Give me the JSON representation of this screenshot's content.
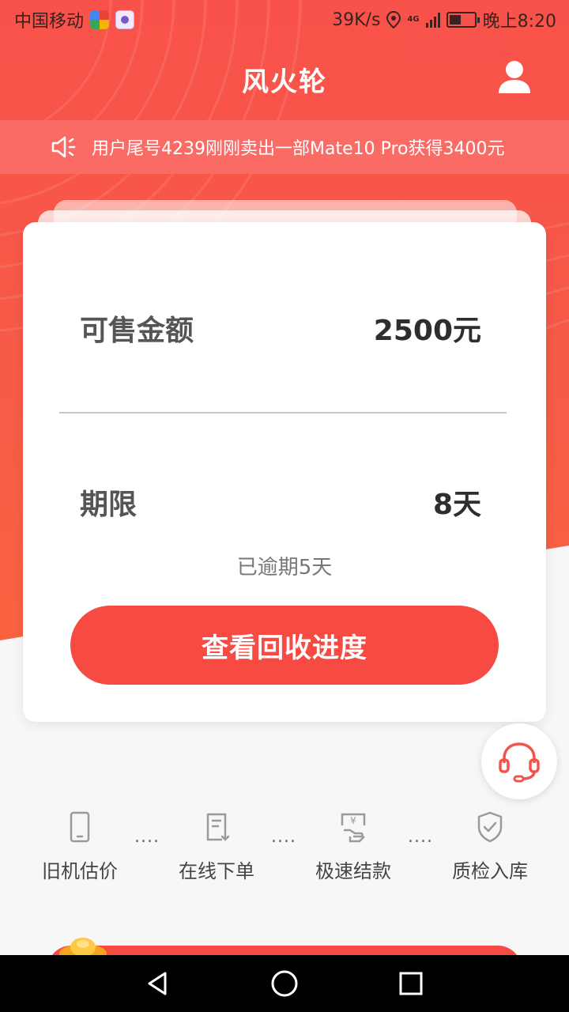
{
  "status_bar": {
    "carrier": "中国移动",
    "speed": "39K/s",
    "network": "4G",
    "time": "晚上8:20"
  },
  "header": {
    "title": "风火轮",
    "user_icon": "user-icon"
  },
  "notice": {
    "icon": "speaker-icon",
    "text": "用户尾号4239刚刚卖出一部Mate10 Pro获得3400元"
  },
  "card": {
    "amount_label": "可售金额",
    "amount_value": "2500元",
    "term_label": "期限",
    "term_value": "8天",
    "overdue_text": "已逾期5天",
    "button_label": "查看回收进度"
  },
  "service": {
    "icon": "headset-icon"
  },
  "steps": [
    {
      "label": "旧机估价",
      "icon": "phone-icon"
    },
    {
      "label": "在线下单",
      "icon": "order-form-icon"
    },
    {
      "label": "极速结款",
      "icon": "payment-icon"
    },
    {
      "label": "质检入库",
      "icon": "shield-check-icon"
    }
  ],
  "step_separator": "....",
  "colors": {
    "primary_red": "#f64a42",
    "notice_bg": "#fb6b66",
    "card_bg": "#ffffff",
    "page_bg": "#f7f7f7"
  },
  "nav_bar": {
    "back": "back-triangle-icon",
    "home": "home-circle-icon",
    "recents": "recents-square-icon"
  }
}
